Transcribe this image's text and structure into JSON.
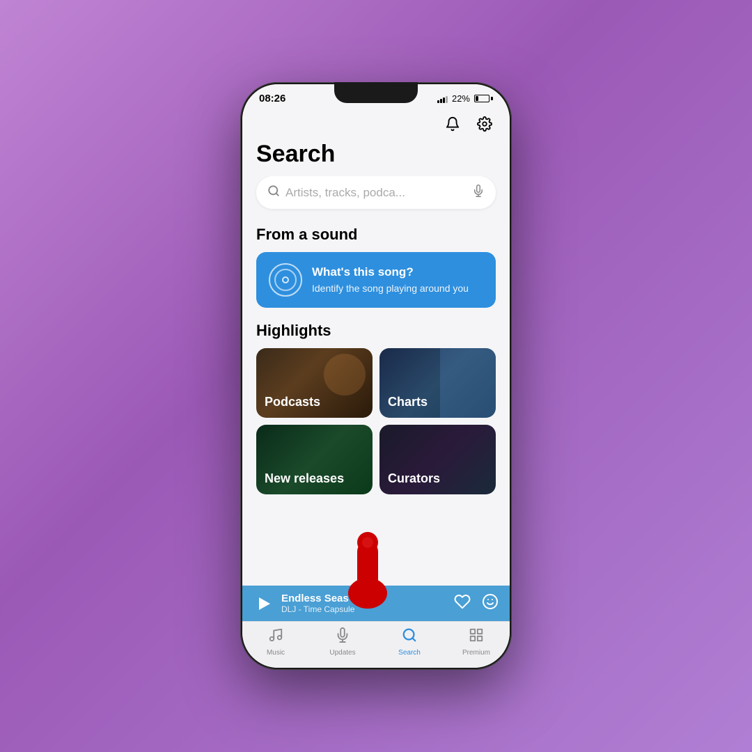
{
  "statusBar": {
    "time": "08:26",
    "battery": "22%"
  },
  "header": {
    "title": "Search",
    "bellLabel": "bell",
    "settingsLabel": "settings"
  },
  "searchBar": {
    "placeholder": "Artists, tracks, podca...",
    "micLabel": "microphone"
  },
  "fromSound": {
    "sectionTitle": "From a sound",
    "card": {
      "title": "What's this song?",
      "subtitle": "Identify the song playing around you"
    }
  },
  "highlights": {
    "sectionTitle": "Highlights",
    "cards": [
      {
        "label": "Podcasts",
        "bg": "podcasts"
      },
      {
        "label": "Charts",
        "bg": "charts"
      },
      {
        "label": "New releases",
        "bg": "new"
      },
      {
        "label": "Curators",
        "bg": "curators"
      }
    ]
  },
  "nowPlaying": {
    "trackTitle": "Endless Seas",
    "trackSubtitle": "DLJ - Time Capsule"
  },
  "tabBar": {
    "tabs": [
      {
        "label": "Music",
        "icon": "♫",
        "active": false
      },
      {
        "label": "Updates",
        "icon": "🎙",
        "active": false
      },
      {
        "label": "Search",
        "icon": "search",
        "active": true
      },
      {
        "label": "Premium",
        "icon": "grid",
        "active": false
      }
    ]
  }
}
